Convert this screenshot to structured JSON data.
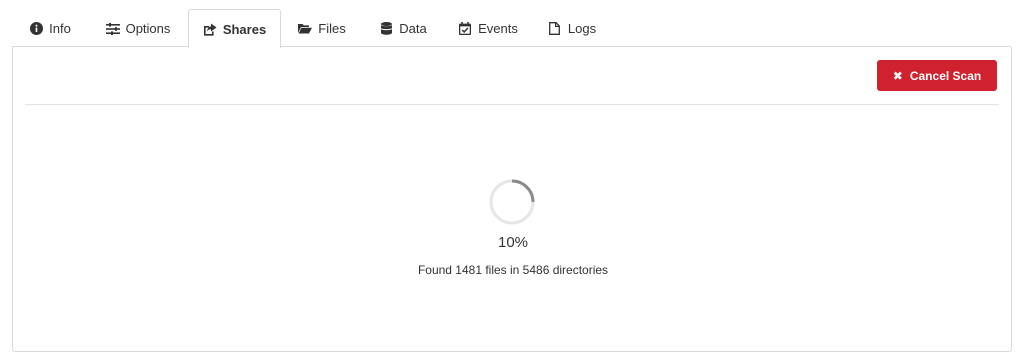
{
  "tabs": [
    {
      "label": "Info",
      "icon": "info-circle-icon",
      "active": false
    },
    {
      "label": "Options",
      "icon": "sliders-icon",
      "active": false
    },
    {
      "label": "Shares",
      "icon": "share-icon",
      "active": true
    },
    {
      "label": "Files",
      "icon": "folder-open-icon",
      "active": false
    },
    {
      "label": "Data",
      "icon": "database-icon",
      "active": false
    },
    {
      "label": "Events",
      "icon": "calendar-check-icon",
      "active": false
    },
    {
      "label": "Logs",
      "icon": "file-icon",
      "active": false
    }
  ],
  "toolbar": {
    "cancel_label": "Cancel Scan",
    "cancel_icon": "times-icon",
    "cancel_color": "#d0222e"
  },
  "progress": {
    "percent_text": "10%",
    "percent_value": 10,
    "status_text": "Found 1481 files in 5486 directories"
  },
  "colors": {
    "border": "#d9d9d9",
    "text": "#333333",
    "spinner_track": "#e6e6e6",
    "spinner_arc": "#8a8a8a"
  }
}
